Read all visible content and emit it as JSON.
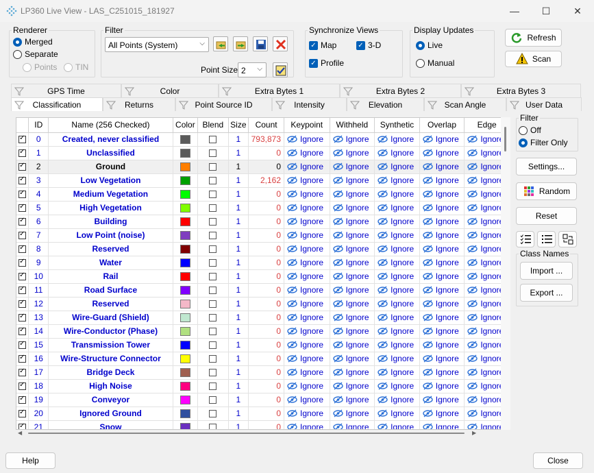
{
  "window": {
    "title": "LP360 Live View - LAS_C251015_181927"
  },
  "renderer": {
    "legend": "Renderer",
    "options": [
      "Merged",
      "Separate"
    ],
    "selected": "Merged",
    "sub_options": [
      "Points",
      "TIN"
    ]
  },
  "filter": {
    "legend": "Filter",
    "value": "All Points (System)",
    "point_size_label": "Point Size:",
    "point_size_value": "2"
  },
  "sync": {
    "legend": "Synchronize Views",
    "map": "Map",
    "three_d": "3-D",
    "profile": "Profile"
  },
  "display_updates": {
    "legend": "Display Updates",
    "live": "Live",
    "manual": "Manual",
    "selected": "Live"
  },
  "buttons": {
    "refresh": "Refresh",
    "scan": "Scan",
    "help": "Help",
    "close": "Close"
  },
  "tabs_top": [
    "GPS Time",
    "Color",
    "Extra Bytes 1",
    "Extra Bytes 2",
    "Extra Bytes 3"
  ],
  "tabs_bottom": [
    "Classification",
    "Returns",
    "Point Source ID",
    "Intensity",
    "Elevation",
    "Scan Angle",
    "User Data"
  ],
  "active_tab": "Classification",
  "grid": {
    "columns": [
      "",
      "ID",
      "Name (256 Checked)",
      "Color",
      "Blend",
      "Size",
      "Count",
      "Keypoint",
      "Withheld",
      "Synthetic",
      "Overlap",
      "Edge"
    ],
    "ignore_label": "Ignore",
    "rows": [
      {
        "id": "0",
        "name": "Created, never classified",
        "color": "#5a5a5a",
        "size": "1",
        "count": "793,873"
      },
      {
        "id": "1",
        "name": "Unclassified",
        "color": "#5a5a5a",
        "size": "1",
        "count": "0"
      },
      {
        "id": "2",
        "name": "Ground",
        "color": "#ff7f00",
        "size": "1",
        "count": "0"
      },
      {
        "id": "3",
        "name": "Low Vegetation",
        "color": "#00a000",
        "size": "1",
        "count": "2,162"
      },
      {
        "id": "4",
        "name": "Medium Vegetation",
        "color": "#00ff00",
        "size": "1",
        "count": "0"
      },
      {
        "id": "5",
        "name": "High Vegetation",
        "color": "#80ff00",
        "size": "1",
        "count": "0"
      },
      {
        "id": "6",
        "name": "Building",
        "color": "#ff0000",
        "size": "1",
        "count": "0"
      },
      {
        "id": "7",
        "name": "Low Point (noise)",
        "color": "#7f3fbf",
        "size": "1",
        "count": "0"
      },
      {
        "id": "8",
        "name": "Reserved",
        "color": "#800000",
        "size": "1",
        "count": "0"
      },
      {
        "id": "9",
        "name": "Water",
        "color": "#0000ff",
        "size": "1",
        "count": "0"
      },
      {
        "id": "10",
        "name": "Rail",
        "color": "#ff0000",
        "size": "1",
        "count": "0"
      },
      {
        "id": "11",
        "name": "Road Surface",
        "color": "#8000ff",
        "size": "1",
        "count": "0"
      },
      {
        "id": "12",
        "name": "Reserved",
        "color": "#f4b8c8",
        "size": "1",
        "count": "0"
      },
      {
        "id": "13",
        "name": "Wire-Guard (Shield)",
        "color": "#c0e8d0",
        "size": "1",
        "count": "0"
      },
      {
        "id": "14",
        "name": "Wire-Conductor (Phase)",
        "color": "#b0e080",
        "size": "1",
        "count": "0"
      },
      {
        "id": "15",
        "name": "Transmission Tower",
        "color": "#0000ff",
        "size": "1",
        "count": "0"
      },
      {
        "id": "16",
        "name": "Wire-Structure Connector",
        "color": "#ffff00",
        "size": "1",
        "count": "0"
      },
      {
        "id": "17",
        "name": "Bridge Deck",
        "color": "#a06050",
        "size": "1",
        "count": "0"
      },
      {
        "id": "18",
        "name": "High Noise",
        "color": "#ff0080",
        "size": "1",
        "count": "0"
      },
      {
        "id": "19",
        "name": "Conveyor",
        "color": "#ff00ff",
        "size": "1",
        "count": "0"
      },
      {
        "id": "20",
        "name": "Ignored Ground",
        "color": "#304f9f",
        "size": "1",
        "count": "0"
      },
      {
        "id": "21",
        "name": "Snow",
        "color": "#6a2fbf",
        "size": "1",
        "count": "0"
      }
    ]
  },
  "side_filter": {
    "legend": "Filter",
    "off": "Off",
    "filter_only": "Filter Only",
    "selected": "Filter Only"
  },
  "side_buttons": {
    "settings": "Settings...",
    "random": "Random",
    "reset": "Reset"
  },
  "class_names": {
    "legend": "Class Names",
    "import": "Import ...",
    "export": "Export ..."
  }
}
